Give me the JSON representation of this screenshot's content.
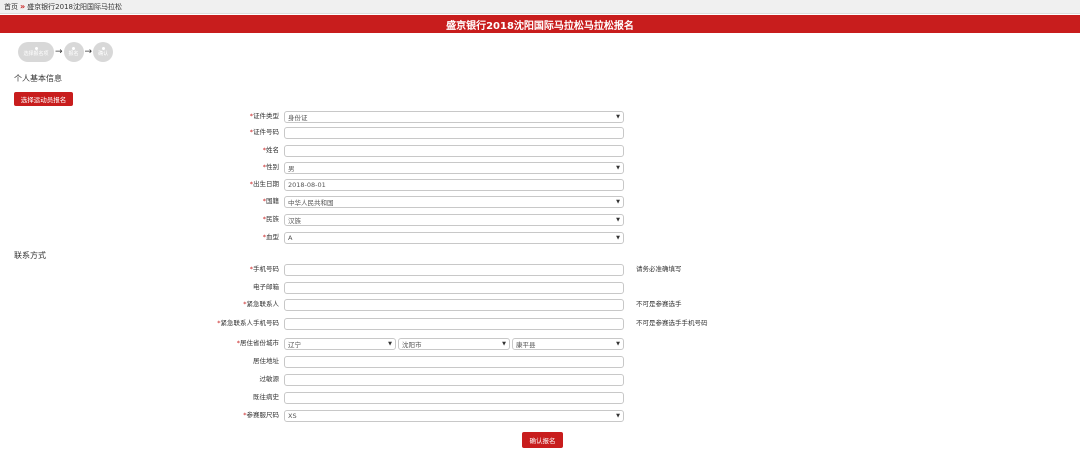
{
  "breadcrumb": {
    "home": "首页",
    "separator": "»",
    "current": "盛京银行2018沈阳国际马拉松"
  },
  "banner": {
    "title": "盛京银行2018沈阳国际马拉松马拉松报名"
  },
  "steps": [
    {
      "label": "选择报名项"
    },
    {
      "label": "报名"
    },
    {
      "label": "确认"
    }
  ],
  "sections": {
    "personal": "个人基本信息",
    "contact": "联系方式"
  },
  "choose_button": "选择运动员报名",
  "personal_fields": {
    "id_type": {
      "label": "证件类型",
      "value": "身份证"
    },
    "id_number": {
      "label": "证件号码",
      "value": ""
    },
    "name": {
      "label": "姓名",
      "value": ""
    },
    "gender": {
      "label": "性别",
      "value": "男"
    },
    "birth_date": {
      "label": "出生日期",
      "value": "2018-08-01"
    },
    "nationality": {
      "label": "国籍",
      "value": "中华人民共和国"
    },
    "ethnicity": {
      "label": "民族",
      "value": "汉族"
    },
    "blood_type": {
      "label": "血型",
      "value": "A"
    }
  },
  "contact_fields": {
    "mobile": {
      "label": "手机号码",
      "value": "",
      "hint": "请务必准确填写"
    },
    "email": {
      "label": "电子邮箱",
      "value": ""
    },
    "emergency_contact": {
      "label": "紧急联系人",
      "value": "",
      "hint": "不可是参赛选手"
    },
    "emergency_phone": {
      "label": "紧急联系人手机号码",
      "value": "",
      "hint": "不可是参赛选手手机号码"
    },
    "residence_city": {
      "label": "居住省份城市",
      "province": "辽宁",
      "city": "沈阳市",
      "district": "康平县"
    },
    "address": {
      "label": "居住地址",
      "value": ""
    },
    "allergy": {
      "label": "过敏源",
      "value": ""
    },
    "medical_history": {
      "label": "既往病史",
      "value": ""
    },
    "shirt_size": {
      "label": "参赛服尺码",
      "value": "XS"
    }
  },
  "required_mark": "*",
  "submit_button": "确认报名",
  "colors": {
    "accent": "#c81d1d",
    "step_inactive": "#d8d8d8"
  },
  "icons": {
    "select_caret": "▼",
    "step_arrow": "→"
  }
}
